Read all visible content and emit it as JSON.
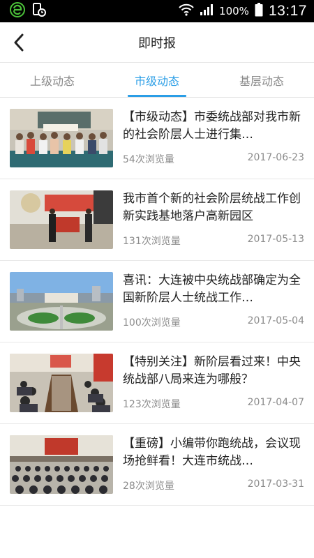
{
  "status_bar": {
    "battery": "100%",
    "time": "13:17",
    "icons": [
      "app-e-icon",
      "device-clock-icon",
      "wifi-icon",
      "signal-icon",
      "battery-icon"
    ]
  },
  "header": {
    "title": "即时报"
  },
  "tabs": [
    {
      "label": "上级动态",
      "active": false
    },
    {
      "label": "市级动态",
      "active": true
    },
    {
      "label": "基层动态",
      "active": false
    }
  ],
  "colors": {
    "accent": "#2b9ee6",
    "text": "#222222",
    "muted": "#8c8c8c"
  },
  "articles": [
    {
      "title": "【市级动态】市委统战部对我市新的社会阶层人士进行集…",
      "views": "54次浏览量",
      "date": "2017-06-23"
    },
    {
      "title": "我市首个新的社会阶层统战工作创新实践基地落户高新园区",
      "views": "131次浏览量",
      "date": "2017-05-13"
    },
    {
      "title": "喜讯：大连被中央统战部确定为全国新阶层人士统战工作…",
      "views": "100次浏览量",
      "date": "2017-05-04"
    },
    {
      "title": "【特别关注】新阶层看过来！中央统战部八局来连为哪般？",
      "views": "123次浏览量",
      "date": "2017-04-07"
    },
    {
      "title": "【重磅】小编带你跑统战，会议现场抢鲜看！大连市统战…",
      "views": "28次浏览量",
      "date": "2017-03-31"
    }
  ]
}
